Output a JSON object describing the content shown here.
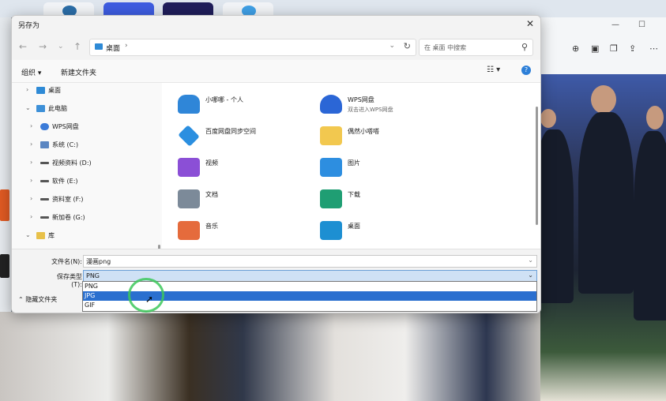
{
  "dialog": {
    "title": "另存为",
    "address": {
      "location": "桌面",
      "separator": "›"
    },
    "search": {
      "placeholder": "在 桌面 中搜索"
    },
    "commands": {
      "organize": "组织 ▾",
      "new_folder": "新建文件夹"
    }
  },
  "tree": {
    "items": [
      {
        "label": "桌面",
        "expanded": false
      },
      {
        "label": "此电脑",
        "expanded": true
      },
      {
        "label": "WPS网盘",
        "expanded": false
      },
      {
        "label": "系统 (C:)",
        "expanded": false
      },
      {
        "label": "视频资料 (D:)",
        "expanded": false
      },
      {
        "label": "软件 (E:)",
        "expanded": false
      },
      {
        "label": "资料室 (F:)",
        "expanded": false
      },
      {
        "label": "新加卷 (G:)",
        "expanded": false
      },
      {
        "label": "库",
        "expanded": true
      }
    ]
  },
  "files": [
    {
      "name": "小哪哪 - 个人",
      "sub": ""
    },
    {
      "name": "WPS网盘",
      "sub": "双击进入WPS网盘"
    },
    {
      "name": "百度网盘同步空间",
      "sub": ""
    },
    {
      "name": "偶然小嗒嗒",
      "sub": ""
    },
    {
      "name": "视频",
      "sub": ""
    },
    {
      "name": "图片",
      "sub": ""
    },
    {
      "name": "文档",
      "sub": ""
    },
    {
      "name": "下载",
      "sub": ""
    },
    {
      "name": "音乐",
      "sub": ""
    },
    {
      "name": "桌面",
      "sub": ""
    }
  ],
  "save": {
    "filename_label": "文件名(N):",
    "filename_value": "漫画png",
    "type_label": "保存类型(T):",
    "type_value": "PNG",
    "hide_folders": "隐藏文件夹",
    "type_options": [
      "PNG",
      "JPG",
      "GIF"
    ],
    "selected_index": 1
  }
}
